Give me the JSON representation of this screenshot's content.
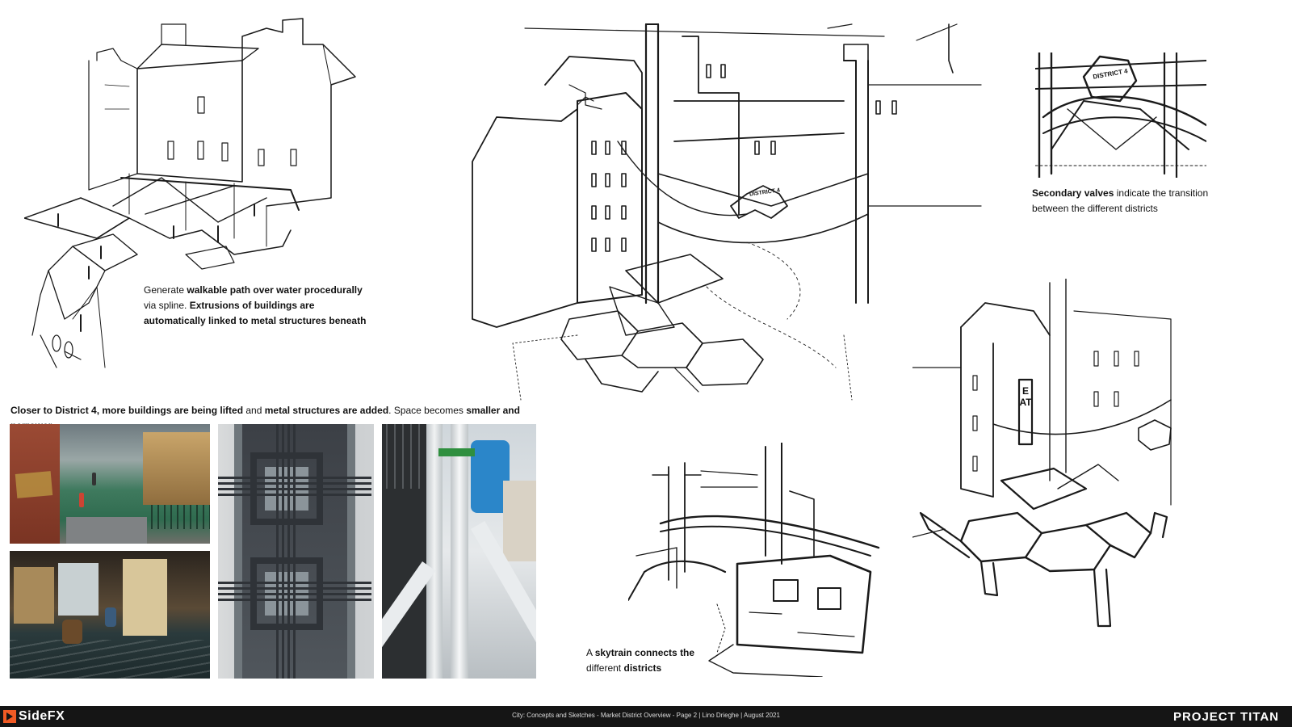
{
  "captions": {
    "walkway": {
      "p1": "Generate ",
      "b1": "walkable path over water procedurally",
      "p2": "via spline. ",
      "b2": "Extrusions of buildings are automatically linked to metal structures beneath"
    },
    "valves": {
      "b1": "Secondary valves",
      "p1": " indicate the transition between the different districts"
    },
    "district": {
      "b1": "Closer to District 4, more buildings are being lifted",
      "p1": " and ",
      "b2": "metal structures are added",
      "p2": ". Space becomes ",
      "b3": "smaller and narrower"
    },
    "skytrain": {
      "p1": "A ",
      "b1": "skytrain connects the",
      "p2": "different ",
      "b2": "districts"
    }
  },
  "sign_text": {
    "valve_main": "DISTRICT 4",
    "valve_top": "DISTRICT 4",
    "eat": "EAT"
  },
  "footer": {
    "logo": "SideFX",
    "center": "City: Concepts and Sketches - Market District Overview - Page 2 | Lino Drieghe | August 2021",
    "right": "PROJECT TITAN"
  },
  "colors": {
    "footer_bg": "#151515",
    "logo_orange": "#f15a24",
    "water_green": "#2f6b4f",
    "wall_red": "#8b3a2a",
    "metal_dark": "#3c4046",
    "pipe_blue": "#2b86c9"
  }
}
